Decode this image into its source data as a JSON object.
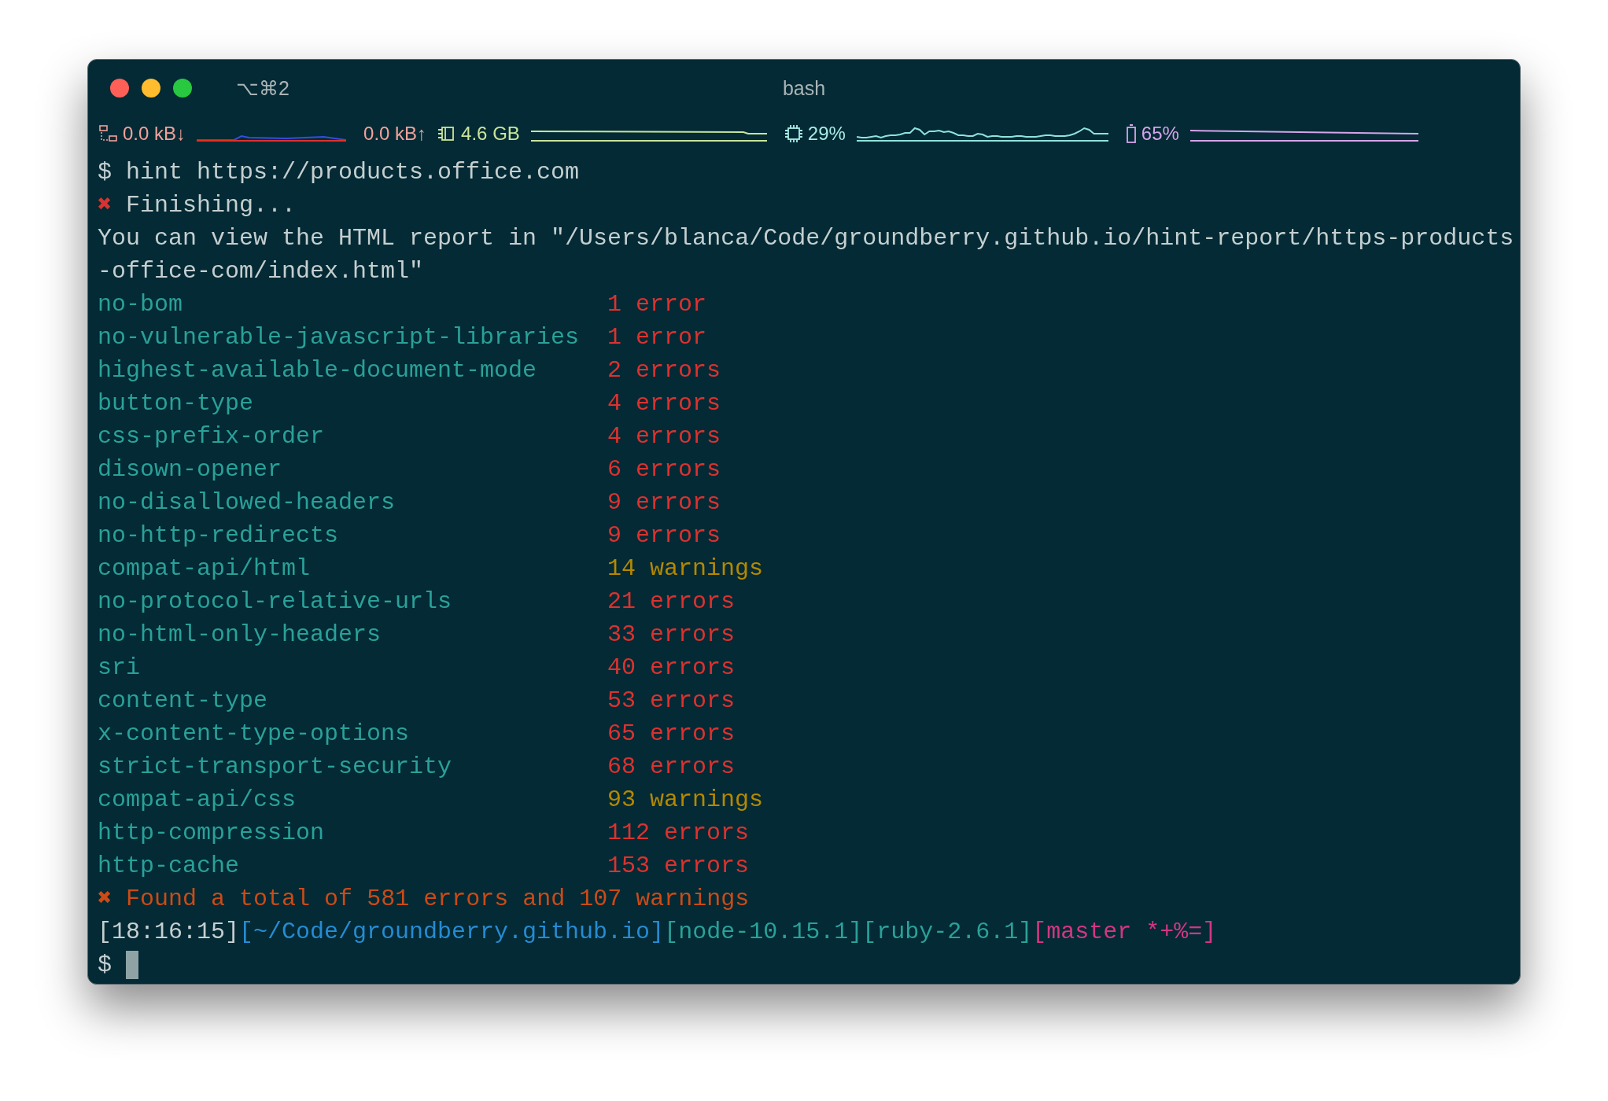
{
  "window": {
    "title": "bash",
    "shortcut": "⌥⌘2"
  },
  "status_bar": {
    "items": [
      {
        "kind": "network_down",
        "text": "0.0 kB↓"
      },
      {
        "kind": "network_up",
        "text": "0.0 kB↑"
      },
      {
        "kind": "memory",
        "text": "4.6 GB"
      },
      {
        "kind": "cpu",
        "text": "29%"
      },
      {
        "kind": "battery",
        "text": "65%"
      }
    ]
  },
  "command": {
    "prompt": "$",
    "text": "hint https://products.office.com"
  },
  "progress": {
    "icon": "✖",
    "text": "Finishing..."
  },
  "output": {
    "lines": [
      "You can view the HTML report in \"/Users/blanca/Code/groundberry.github.io/hint-report/https-products",
      "-office-com/index.html\""
    ]
  },
  "rules": [
    {
      "name": "no-bom",
      "result": "1 error",
      "kind": "error"
    },
    {
      "name": "no-vulnerable-javascript-libraries",
      "result": "1 error",
      "kind": "error"
    },
    {
      "name": "highest-available-document-mode",
      "result": "2 errors",
      "kind": "error"
    },
    {
      "name": "button-type",
      "result": "4 errors",
      "kind": "error"
    },
    {
      "name": "css-prefix-order",
      "result": "4 errors",
      "kind": "error"
    },
    {
      "name": "disown-opener",
      "result": "6 errors",
      "kind": "error"
    },
    {
      "name": "no-disallowed-headers",
      "result": "9 errors",
      "kind": "error"
    },
    {
      "name": "no-http-redirects",
      "result": "9 errors",
      "kind": "error"
    },
    {
      "name": "compat-api/html",
      "result": "14 warnings",
      "kind": "warning"
    },
    {
      "name": "no-protocol-relative-urls",
      "result": "21 errors",
      "kind": "error"
    },
    {
      "name": "no-html-only-headers",
      "result": "33 errors",
      "kind": "error"
    },
    {
      "name": "sri",
      "result": "40 errors",
      "kind": "error"
    },
    {
      "name": "content-type",
      "result": "53 errors",
      "kind": "error"
    },
    {
      "name": "x-content-type-options",
      "result": "65 errors",
      "kind": "error"
    },
    {
      "name": "strict-transport-security",
      "result": "68 errors",
      "kind": "error"
    },
    {
      "name": "compat-api/css",
      "result": "93 warnings",
      "kind": "warning"
    },
    {
      "name": "http-compression",
      "result": "112 errors",
      "kind": "error"
    },
    {
      "name": "http-cache",
      "result": "153 errors",
      "kind": "error"
    }
  ],
  "summary": {
    "icon": "✖",
    "text": "Found a total of 581 errors and 107 warnings"
  },
  "prompt_line": {
    "segments": [
      {
        "text": "[18:16:15]",
        "color": "#c5cfcf"
      },
      {
        "text": "[~/Code/groundberry.github.io]",
        "color": "#268bd2"
      },
      {
        "text": "[node-10.15.1]",
        "color": "#2aa198"
      },
      {
        "text": "[ruby-2.6.1]",
        "color": "#2aa198"
      },
      {
        "text": "[master *+%=]",
        "color": "#d33682"
      }
    ]
  },
  "input": {
    "prompt": "$"
  }
}
